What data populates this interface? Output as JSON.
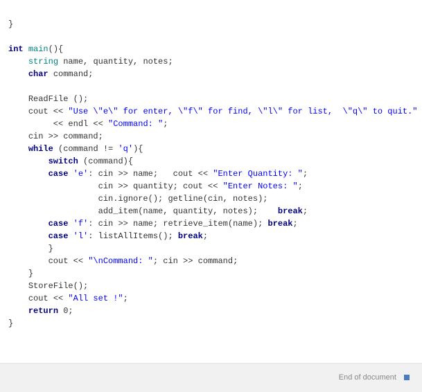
{
  "code": {
    "l0": "}",
    "l1": "",
    "kw_int": "int",
    "main_name": "main",
    "main_paren": "(){",
    "kw_string": "string",
    "vars_line": " name, quantity, notes;",
    "kw_char": "char",
    "char_line": " command;",
    "readfile": "ReadFile ();",
    "cout1a": "cout << ",
    "str1": "\"Use \\\"e\\\" for enter, \\\"f\\\" for find, \\\"l\\\" for list,  \\\"q\\\" to quit.\"",
    "cout1b": "         << endl << ",
    "str2": "\"Command: \"",
    "semcol": ";",
    "cinline": "cin >> command;",
    "kw_while": "while",
    "while_cond": " (command != ",
    "chr_q": "'q'",
    "while_close": "){",
    "kw_switch": "switch",
    "switch_cond": " (command){",
    "kw_case": "case",
    "chr_e": "'e'",
    "case_e_1a": ": cin >> name;   cout << ",
    "str_eq": "\"Enter Quantity: \"",
    "case_e_2a": "cin >> quantity; cout << ",
    "str_en": "\"Enter Notes: \"",
    "case_e_3": "cin.ignore(); getline(cin, notes);",
    "case_e_4": "add_item(name, quantity, notes);    ",
    "kw_break": "break",
    "chr_f": "'f'",
    "case_f": ": cin >> name; retrieve_item(name); ",
    "chr_l": "'l'",
    "case_l": ": listAllItems(); ",
    "close_brace": "}",
    "cout3a": "cout << ",
    "str3": "\"\\nCommand: \"",
    "cout3b": "; cin >> command;",
    "storefile": "StoreFile();",
    "cout4a": "cout << ",
    "str4": "\"All set !\"",
    "kw_return": "return",
    "ret_val": " 0;"
  },
  "footer": {
    "text": "End of document"
  }
}
